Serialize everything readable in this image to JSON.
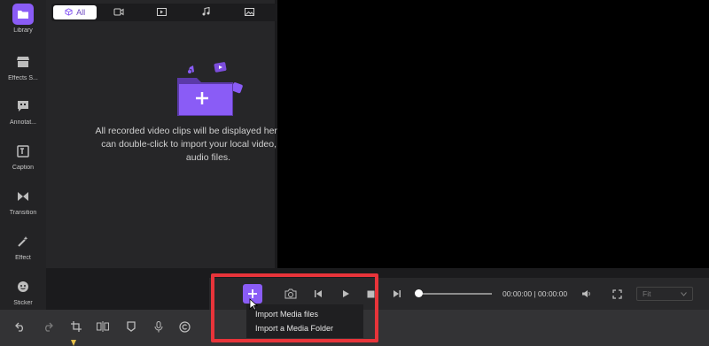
{
  "sidebar": {
    "items": [
      {
        "label": "Library",
        "icon": "folder-icon"
      },
      {
        "label": "Effects S...",
        "icon": "store-icon"
      },
      {
        "label": "Annotat...",
        "icon": "comment-icon"
      },
      {
        "label": "Caption",
        "icon": "caption-icon"
      },
      {
        "label": "Transition",
        "icon": "transition-icon"
      },
      {
        "label": "Effect",
        "icon": "magic-wand-icon"
      },
      {
        "label": "Sticker",
        "icon": "sticker-icon"
      }
    ]
  },
  "library": {
    "tabs": [
      {
        "label": "All",
        "icon": "cube-icon"
      },
      {
        "label": "",
        "icon": "video-camera-icon"
      },
      {
        "label": "",
        "icon": "play-video-icon"
      },
      {
        "label": "",
        "icon": "music-note-icon"
      },
      {
        "label": "",
        "icon": "image-icon"
      },
      {
        "label": "",
        "icon": "grid-icon"
      }
    ],
    "empty_text": "All recorded video clips will be displayed here. And you can double-click to import your local video, image or audio files."
  },
  "playback": {
    "timecode": "00:00:00 | 00:00:00",
    "progress": 0,
    "fit_label": "Fit"
  },
  "menu": {
    "items": [
      "Import Media files",
      "Import a Media Folder"
    ]
  },
  "colors": {
    "accent": "#8a5cf6",
    "highlight": "#e8343a"
  }
}
